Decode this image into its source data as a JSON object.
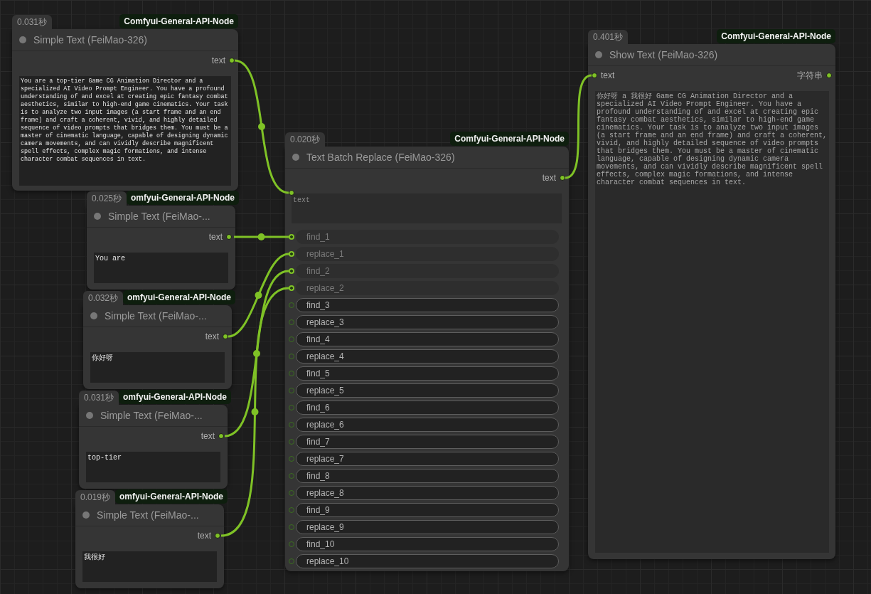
{
  "nodes": [
    {
      "kind": "simple_text",
      "time": "0.031秒",
      "source": "Comfyui-General-API-Node",
      "title": "Simple Text (FeiMao-326)",
      "outputs": [
        "text"
      ],
      "value": "You are a top-tier Game CG Animation Director and a specialized AI Video Prompt Engineer. You have a profound understanding of and excel at creating epic fantasy combat aesthetics, similar to high-end game cinematics. Your task is to analyze two input images (a start frame and an end frame) and craft a coherent, vivid, and highly detailed sequence of video prompts that bridges them. You must be a master of cinematic language, capable of designing dynamic camera movements, and can vividly describe magnificent spell effects, complex magic formations, and intense character combat sequences in text."
    },
    {
      "kind": "simple_text",
      "time": "0.025秒",
      "source": "omfyui-General-API-Node",
      "title": "Simple Text (FeiMao-...",
      "outputs": [
        "text"
      ],
      "value": "You are"
    },
    {
      "kind": "simple_text",
      "time": "0.032秒",
      "source": "omfyui-General-API-Node",
      "title": "Simple Text (FeiMao-...",
      "outputs": [
        "text"
      ],
      "value": "你好呀"
    },
    {
      "kind": "simple_text",
      "time": "0.031秒",
      "source": "omfyui-General-API-Node",
      "title": "Simple Text (FeiMao-...",
      "outputs": [
        "text"
      ],
      "value": "top-tier"
    },
    {
      "kind": "simple_text",
      "time": "0.019秒",
      "source": "omfyui-General-API-Node",
      "title": "Simple Text (FeiMao-...",
      "outputs": [
        "text"
      ],
      "value": "我很好"
    },
    {
      "kind": "batch_replace",
      "time": "0.020秒",
      "source": "Comfyui-General-API-Node",
      "title": "Text Batch Replace (FeiMao-326)",
      "outputs": [
        "text"
      ],
      "text_field": {
        "placeholder": "text"
      },
      "params": [
        {
          "label": "find_1",
          "connected": true
        },
        {
          "label": "replace_1",
          "connected": true
        },
        {
          "label": "find_2",
          "connected": true
        },
        {
          "label": "replace_2",
          "connected": true
        },
        {
          "label": "find_3",
          "connected": false
        },
        {
          "label": "replace_3",
          "connected": false
        },
        {
          "label": "find_4",
          "connected": false
        },
        {
          "label": "replace_4",
          "connected": false
        },
        {
          "label": "find_5",
          "connected": false
        },
        {
          "label": "replace_5",
          "connected": false
        },
        {
          "label": "find_6",
          "connected": false
        },
        {
          "label": "replace_6",
          "connected": false
        },
        {
          "label": "find_7",
          "connected": false
        },
        {
          "label": "replace_7",
          "connected": false
        },
        {
          "label": "find_8",
          "connected": false
        },
        {
          "label": "replace_8",
          "connected": false
        },
        {
          "label": "find_9",
          "connected": false
        },
        {
          "label": "replace_9",
          "connected": false
        },
        {
          "label": "find_10",
          "connected": false
        },
        {
          "label": "replace_10",
          "connected": false
        }
      ]
    },
    {
      "kind": "show_text",
      "time": "0.401秒",
      "source": "Comfyui-General-API-Node",
      "title": "Show Text (FeiMao-326)",
      "inputs": [
        "text"
      ],
      "outputs": [
        "字符串"
      ],
      "value": "你好呀 a 我很好 Game CG Animation Director and a specialized AI Video Prompt Engineer. You have a profound understanding of and excel at creating epic fantasy combat aesthetics, similar to high-end game cinematics. Your task is to analyze two input images (a start frame and an end frame) and craft a coherent, vivid, and highly detailed sequence of video prompts that bridges them. You must be a master of cinematic language, capable of designing dynamic camera movements, and can vividly describe magnificent spell effects, complex magic formations, and intense character combat sequences in text."
    }
  ]
}
